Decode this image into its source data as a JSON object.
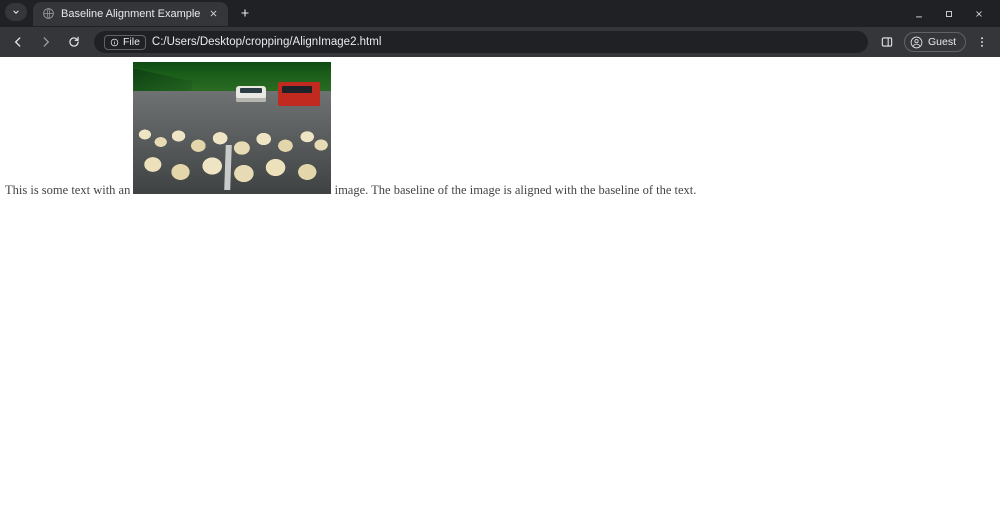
{
  "window": {
    "tab_title": "Baseline Alignment Example",
    "file_chip_label": "File",
    "url": "C:/Users/Desktop/cropping/AlignImage2.html",
    "guest_label": "Guest"
  },
  "page": {
    "text_before": "This is some text with an ",
    "text_after": " image. The baseline of the image is aligned with the baseline of the text.",
    "image_alt": "sheep-on-road"
  }
}
